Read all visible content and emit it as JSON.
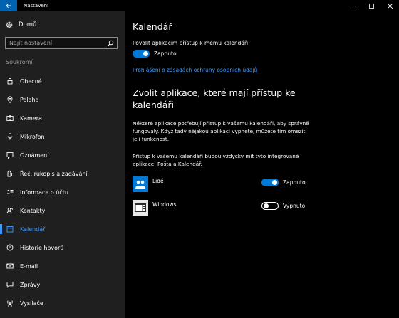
{
  "window": {
    "title": "Nastavení"
  },
  "sidebar": {
    "home_label": "Domů",
    "search_placeholder": "Najít nastavení",
    "section_label": "Soukromí",
    "items": [
      {
        "label": "Obecné",
        "icon": "lock-icon"
      },
      {
        "label": "Poloha",
        "icon": "location-icon"
      },
      {
        "label": "Kamera",
        "icon": "camera-icon"
      },
      {
        "label": "Mikrofon",
        "icon": "microphone-icon"
      },
      {
        "label": "Oznámení",
        "icon": "notification-icon"
      },
      {
        "label": "Řeč, rukopis a zadávání",
        "icon": "pen-icon"
      },
      {
        "label": "Informace o účtu",
        "icon": "account-info-icon"
      },
      {
        "label": "Kontakty",
        "icon": "contacts-icon"
      },
      {
        "label": "Kalendář",
        "icon": "calendar-icon",
        "active": true
      },
      {
        "label": "Historie hovorů",
        "icon": "history-icon"
      },
      {
        "label": "E-mail",
        "icon": "mail-icon"
      },
      {
        "label": "Zprávy",
        "icon": "messages-icon"
      },
      {
        "label": "Vysílače",
        "icon": "radio-icon"
      }
    ]
  },
  "main": {
    "title": "Kalendář",
    "toggle_label": "Povolit aplikacím přístup k mému kalendáři",
    "toggle_state": "Zapnuto",
    "privacy_link": "Prohlášení o zásadách ochrany osobních údajů",
    "section_heading": "Zvolit aplikace, které mají přístup ke kalendáři",
    "description": "Některé aplikace potřebují přístup k vašemu kalendáři, aby správně fungovaly. Když tady nějakou aplikaci vypnete, můžete tím omezit její funkčnost.",
    "builtin_note": "Přístup k vašemu kalendáři budou vždycky mít tyto integrované aplikace: Pošta a Kalendář.",
    "apps": [
      {
        "name": "Lidé",
        "state": "Zapnuto",
        "on": true
      },
      {
        "name": "Windows",
        "state": "Vypnuto",
        "on": false
      }
    ]
  },
  "colors": {
    "accent": "#0078d7",
    "link": "#3f9cff",
    "sidebar_bg": "#1f1f1f",
    "main_bg": "#000000"
  }
}
